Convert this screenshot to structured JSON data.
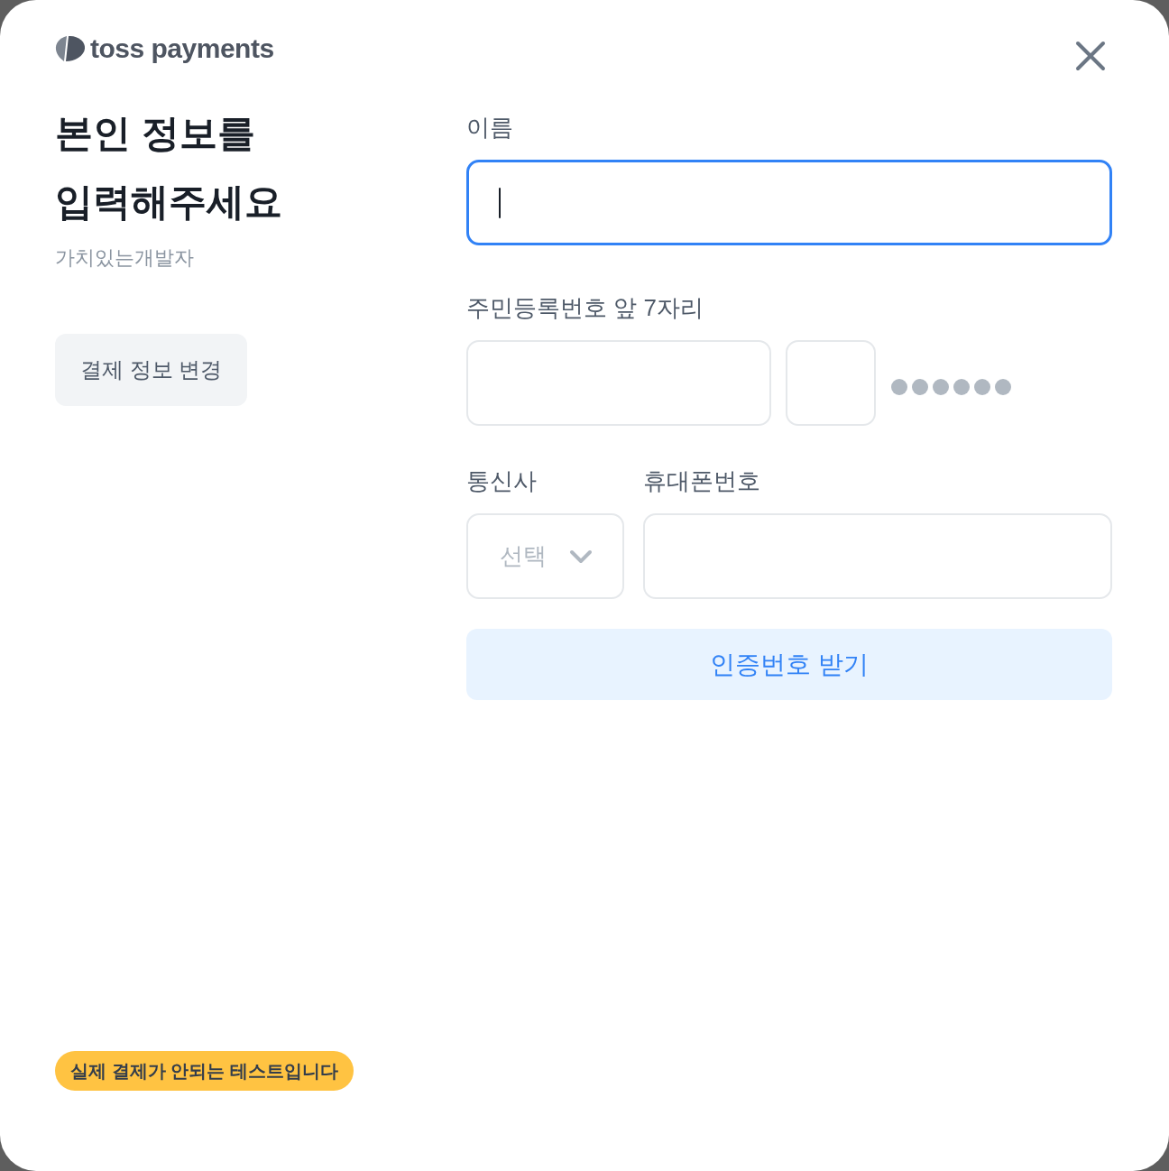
{
  "header": {
    "logo_text": "toss payments"
  },
  "intro": {
    "title": "본인 정보를 입력해주세요",
    "merchant": "가치있는개발자",
    "change_button": "결제 정보 변경"
  },
  "form": {
    "name": {
      "label": "이름",
      "focused": true
    },
    "rrn": {
      "label": "주민등록번호 앞 7자리",
      "inputs": [
        {
          "focused": false
        },
        {
          "focused": false
        }
      ]
    },
    "carrier": {
      "label": "통신사",
      "placeholder": "선택"
    },
    "phone": {
      "label": "휴대폰번호",
      "focused": false
    },
    "submit_button": "인증번호 받기"
  },
  "test_badge": "실제 결제가 안되는 테스트입니다"
}
